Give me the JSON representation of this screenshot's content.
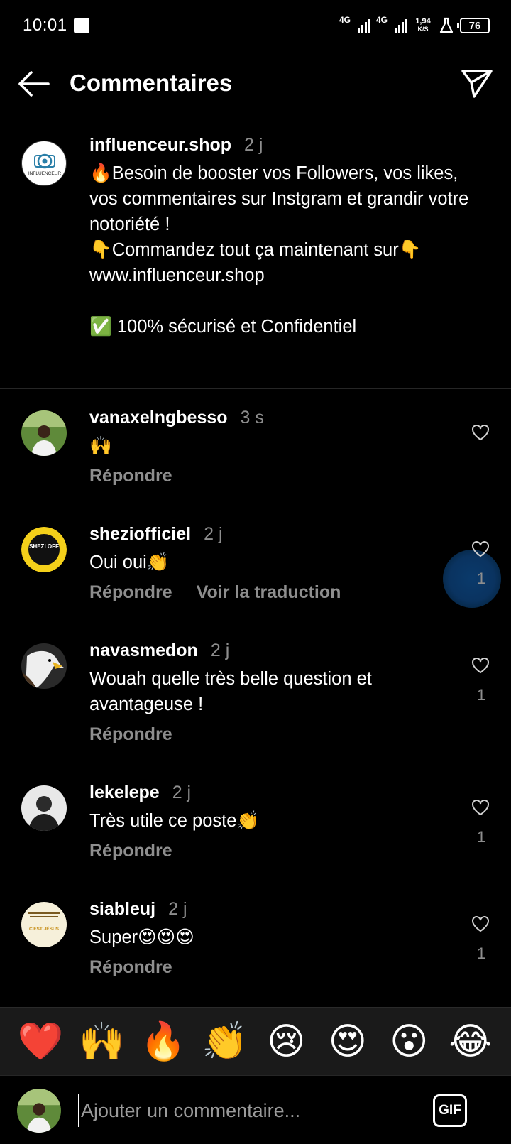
{
  "status_bar": {
    "time": "10:01",
    "network1": "4G",
    "network2": "4G",
    "speed_value": "1,94",
    "speed_unit": "K/S",
    "battery": "76"
  },
  "header": {
    "title": "Commentaires"
  },
  "caption": {
    "username": "influenceur.shop",
    "time": "2 j",
    "text": "🔥Besoin de booster vos Followers, vos likes, vos commentaires sur Instgram et grandir votre notoriété !\n👇Commandez tout ça maintenant sur👇\n www.influenceur.shop\n\n✅ 100% sécurisé et Confidentiel",
    "avatar_text": "INFLUENCEUR"
  },
  "comments": [
    {
      "username": "vanaxelngbesso",
      "time": "3 s",
      "text": "🙌",
      "reply": "Répondre",
      "likes": ""
    },
    {
      "username": "sheziofficiel",
      "time": "2 j",
      "text": "Oui oui👏",
      "reply": "Répondre",
      "translate": "Voir la traduction",
      "likes": "1",
      "avatar_text": "SHEZI OFF"
    },
    {
      "username": "navasmedon",
      "time": "2 j",
      "text": "Wouah quelle très belle question et avantageuse !",
      "reply": "Répondre",
      "likes": "1"
    },
    {
      "username": "lekelepe",
      "time": "2 j",
      "text": "Très utile ce poste👏",
      "reply": "Répondre",
      "likes": "1"
    },
    {
      "username": "siableuj",
      "time": "2 j",
      "text": "Super😍😍😍",
      "reply": "Répondre",
      "likes": "1",
      "avatar_text": "C'EST JÉSUS"
    }
  ],
  "emoji_bar": [
    "❤️",
    "🙌",
    "🔥",
    "👏",
    "😢",
    "😍",
    "😮",
    "😂"
  ],
  "input": {
    "placeholder": "Ajouter un commentaire...",
    "gif_label": "GIF"
  },
  "colors": {
    "background": "#000000",
    "secondary_text": "#8e8e8e",
    "emoji_bar_bg": "#1a1a1a"
  }
}
